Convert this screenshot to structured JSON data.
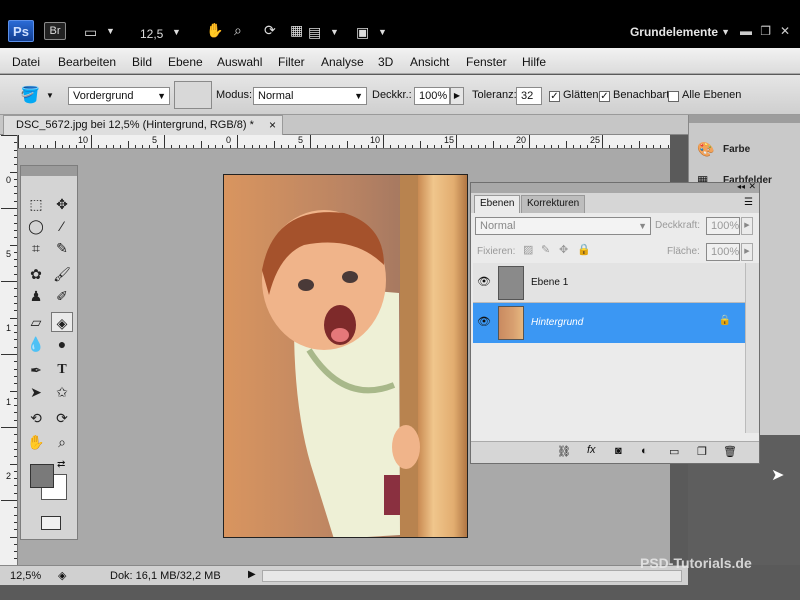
{
  "appbar": {
    "ps_logo": "Ps",
    "br_logo": "Br",
    "zoom": "12,5",
    "workspace": "Grundelemente"
  },
  "menus": [
    "Datei",
    "Bearbeiten",
    "Bild",
    "Ebene",
    "Auswahl",
    "Filter",
    "Analyse",
    "3D",
    "Ansicht",
    "Fenster",
    "Hilfe"
  ],
  "options": {
    "fill_source": "Vordergrund",
    "modus_label": "Modus:",
    "modus_value": "Normal",
    "deckkraft_label": "Deckkr.:",
    "deckkraft_value": "100%",
    "toleranz_label": "Toleranz:",
    "toleranz_value": "32",
    "glaetten_label": "Glätten",
    "benachbart_label": "Benachbart",
    "alle_ebenen_label": "Alle Ebenen",
    "glaetten_checked": true,
    "benachbart_checked": true,
    "alle_ebenen_checked": false
  },
  "document": {
    "tab_title": "DSC_5672.jpg bei 12,5% (Hintergrund, RGB/8) *",
    "close": "×"
  },
  "rulers": {
    "h_labels": [
      "10",
      "5",
      "0",
      "5",
      "10",
      "15",
      "20",
      "25"
    ],
    "v_labels": [
      "0",
      "5",
      "1",
      "1",
      "2"
    ]
  },
  "dock": {
    "items": [
      "Farbe",
      "Farbfelder"
    ]
  },
  "layers_panel": {
    "tabs": [
      "Ebenen",
      "Korrekturen"
    ],
    "blend_mode": "Normal",
    "opacity_label": "Deckkraft:",
    "opacity_value": "100%",
    "lock_label": "Fixieren:",
    "fill_label": "Fläche:",
    "fill_value": "100%",
    "layers": [
      {
        "name": "Ebene 1",
        "selected": false
      },
      {
        "name": "Hintergrund",
        "selected": true
      }
    ]
  },
  "status": {
    "zoom": "12,5%",
    "doc_info": "Dok: 16,1 MB/32,2 MB"
  },
  "watermark": "PSD-Tutorials.de",
  "colors": {
    "selection": "#3b97f3",
    "app_black": "#000000",
    "panel_gray": "#d6d6d6"
  }
}
